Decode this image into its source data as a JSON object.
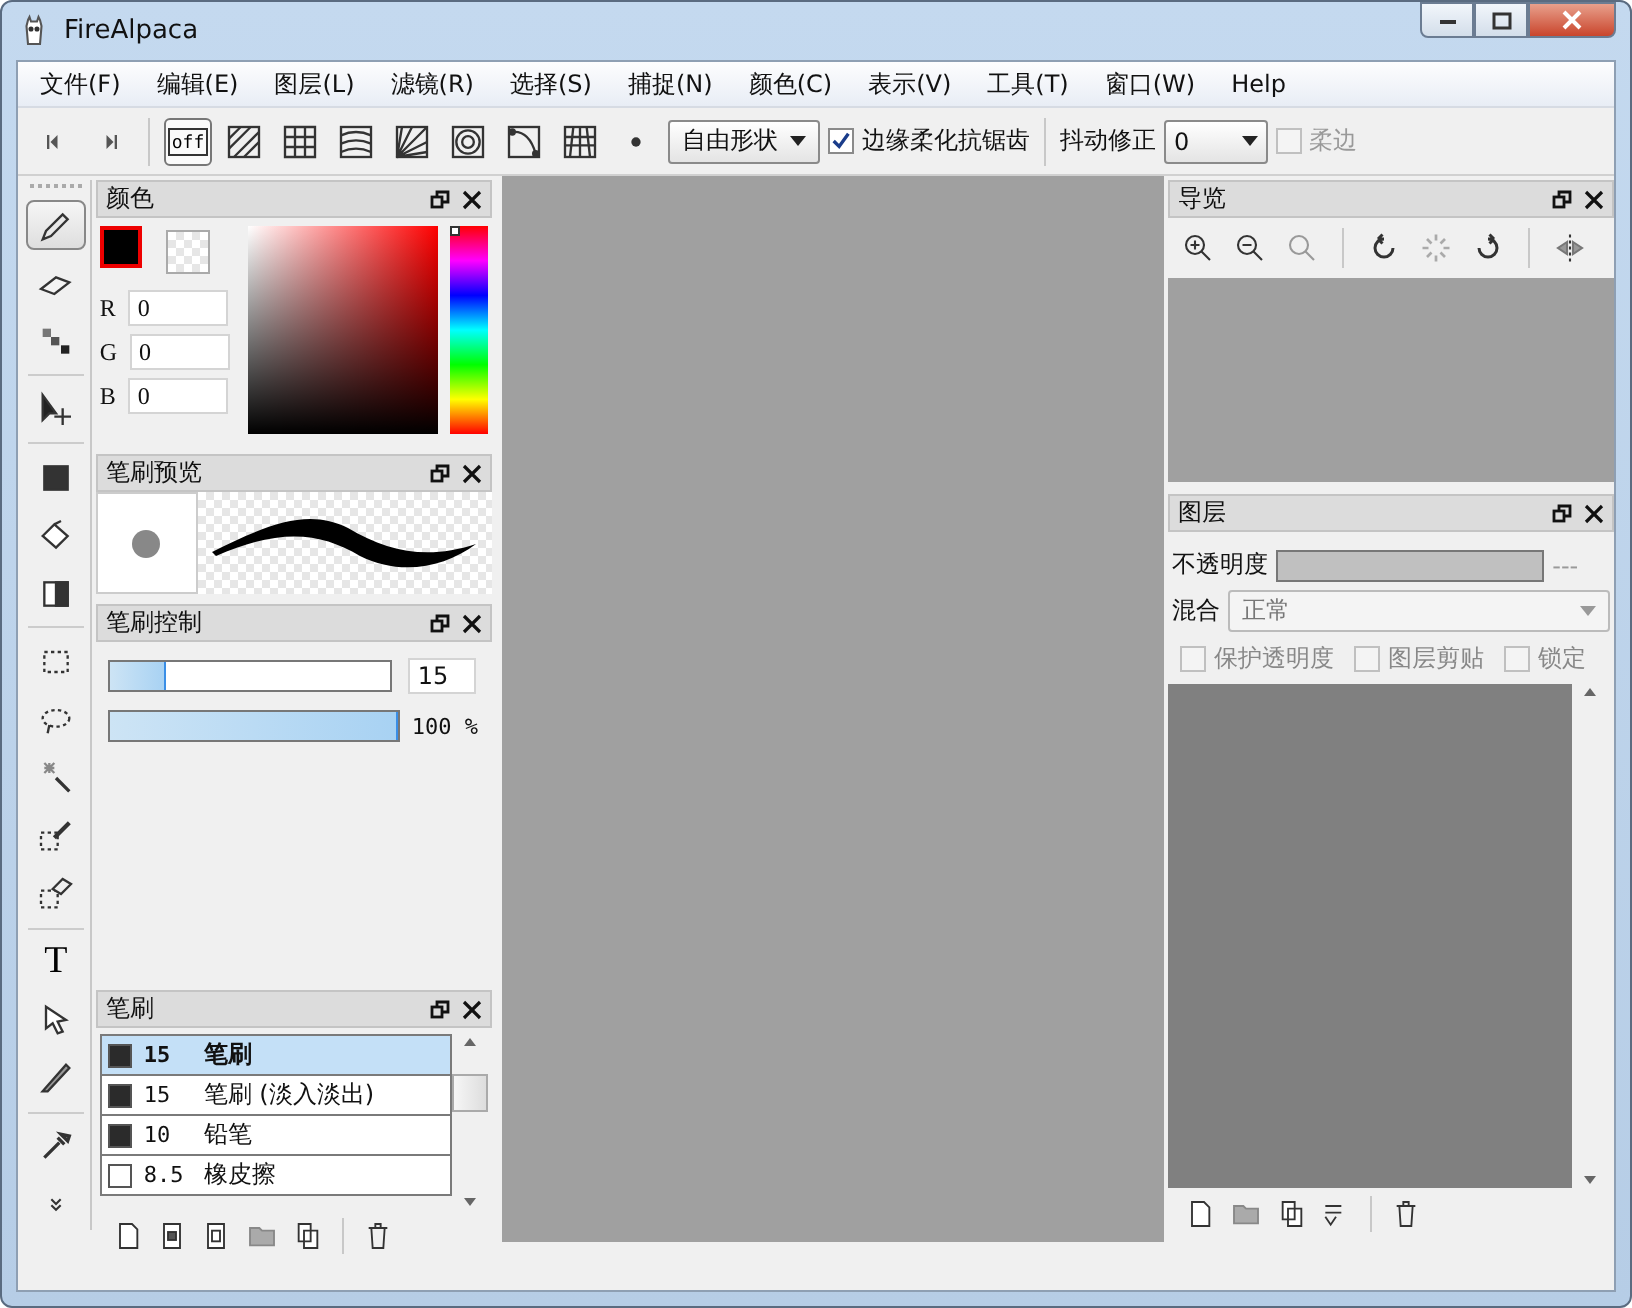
{
  "window": {
    "title": "FireAlpaca"
  },
  "menu": [
    "文件(F)",
    "编辑(E)",
    "图层(L)",
    "滤镜(R)",
    "选择(S)",
    "捕捉(N)",
    "颜色(C)",
    "表示(V)",
    "工具(T)",
    "窗口(W)",
    "Help"
  ],
  "toolbar": {
    "snap_modes": [
      {
        "kind": "off",
        "label": "off",
        "selected": true
      },
      {
        "kind": "parallel",
        "selected": false
      },
      {
        "kind": "grid",
        "selected": false
      },
      {
        "kind": "curve-lines",
        "selected": false
      },
      {
        "kind": "radial",
        "selected": false
      },
      {
        "kind": "concentric",
        "selected": false
      },
      {
        "kind": "curve",
        "selected": false
      },
      {
        "kind": "perspective",
        "selected": false
      },
      {
        "kind": "dot",
        "selected": false
      }
    ],
    "shape": "自由形状",
    "antialias": {
      "label": "边缘柔化抗锯齿",
      "checked": true
    },
    "stabilizer": {
      "label": "抖动修正",
      "value": "0"
    },
    "soft_edge": {
      "label": "柔边",
      "checked": false,
      "disabled": true
    }
  },
  "tools": [
    {
      "kind": "pen",
      "selected": true
    },
    {
      "kind": "eraser",
      "selected": false
    },
    {
      "kind": "dots",
      "selected": false
    },
    {
      "kind": "move",
      "selected": false
    },
    {
      "kind": "fill",
      "selected": false
    },
    {
      "kind": "bucket",
      "selected": false
    },
    {
      "kind": "gradient",
      "selected": false
    },
    {
      "kind": "rect-select",
      "selected": false
    },
    {
      "kind": "lasso",
      "selected": false
    },
    {
      "kind": "wand",
      "selected": false
    },
    {
      "kind": "select-pen",
      "selected": false
    },
    {
      "kind": "select-eraser",
      "selected": false
    },
    {
      "kind": "text",
      "label": "T",
      "selected": false
    },
    {
      "kind": "pointer",
      "selected": false
    },
    {
      "kind": "blade",
      "selected": false
    },
    {
      "kind": "eyedropper",
      "selected": false
    },
    {
      "kind": "more",
      "selected": false
    }
  ],
  "color_panel": {
    "title": "颜色",
    "hue": {
      "level": 0
    },
    "channels": [
      {
        "label": "R",
        "value": "0"
      },
      {
        "label": "G",
        "value": "0"
      },
      {
        "label": "B",
        "value": "0"
      }
    ]
  },
  "brush_preview": {
    "title": "笔刷预览"
  },
  "brush_control": {
    "title": "笔刷控制",
    "size": {
      "level": 0.2,
      "value": "15"
    },
    "opacity": {
      "level": 1,
      "reading": "100 %"
    }
  },
  "brush_panel": {
    "title": "笔刷",
    "brushes": [
      {
        "color": "#2b2b2b",
        "size": "15",
        "name": "笔刷",
        "selected": true
      },
      {
        "color": "#2b2b2b",
        "size": "15",
        "name": "笔刷 (淡入淡出)",
        "selected": false
      },
      {
        "color": "#2b2b2b",
        "size": "10",
        "name": "铅笔",
        "selected": false
      },
      {
        "color": "#ffffff",
        "size": "8.5",
        "name": "橡皮擦",
        "selected": false
      }
    ]
  },
  "navigator": {
    "title": "导览"
  },
  "layers": {
    "title": "图层",
    "opacity_label": "不透明度",
    "opacity_reading": "---",
    "blend_label": "混合",
    "blend_mode": "正常",
    "options": [
      {
        "label": "保护透明度",
        "checked": false
      },
      {
        "label": "图层剪贴",
        "checked": false
      },
      {
        "label": "锁定",
        "checked": false
      }
    ]
  }
}
